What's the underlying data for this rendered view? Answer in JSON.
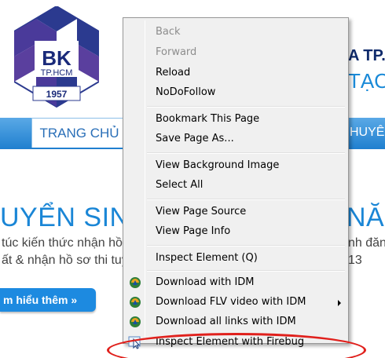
{
  "background_page": {
    "logo": {
      "initials": "BK",
      "campus": "TP.HCM",
      "year": "1957"
    },
    "header_line1": "A TP.",
    "header_line2": "TẠO",
    "nav": {
      "home": "TRANG CHỦ",
      "right_partial": "HUYÊN"
    },
    "banner": {
      "title_left": "UYỂN SINH",
      "title_right": "NĂI",
      "text_line1_left": "túc kiến thức nhận hồ",
      "text_line1_right": "nh đăng",
      "text_line2_left": "ất & nhận hồ sơ thi tuy",
      "text_line2_right": "13",
      "more_button": "m hiểu thêm »"
    }
  },
  "context_menu": {
    "items": [
      {
        "label": "Back",
        "disabled": true
      },
      {
        "label": "Forward",
        "disabled": true
      },
      {
        "label": "Reload",
        "disabled": false
      },
      {
        "label": "NoDoFollow",
        "disabled": false
      },
      {
        "label": "Bookmark This Page",
        "disabled": false
      },
      {
        "label": "Save Page As...",
        "disabled": false
      },
      {
        "label": "View Background Image",
        "disabled": false
      },
      {
        "label": "Select All",
        "disabled": false
      },
      {
        "label": "View Page Source",
        "disabled": false
      },
      {
        "label": "View Page Info",
        "disabled": false
      },
      {
        "label": "Inspect Element (Q)",
        "disabled": false
      },
      {
        "label": "Download with IDM",
        "icon": "idm-icon"
      },
      {
        "label": "Download FLV video with IDM",
        "icon": "idm-icon",
        "submenu": true
      },
      {
        "label": "Download all links with IDM",
        "icon": "idm-icon"
      },
      {
        "label": "Inspect Element with Firebug",
        "icon": "firebug-cursor-icon"
      }
    ]
  },
  "annotation_color": "#e0201c",
  "colors": {
    "brand_blue": "#1a86d6",
    "logo_navy": "#2b3a8f",
    "logo_purple": "#5a3f9e"
  }
}
